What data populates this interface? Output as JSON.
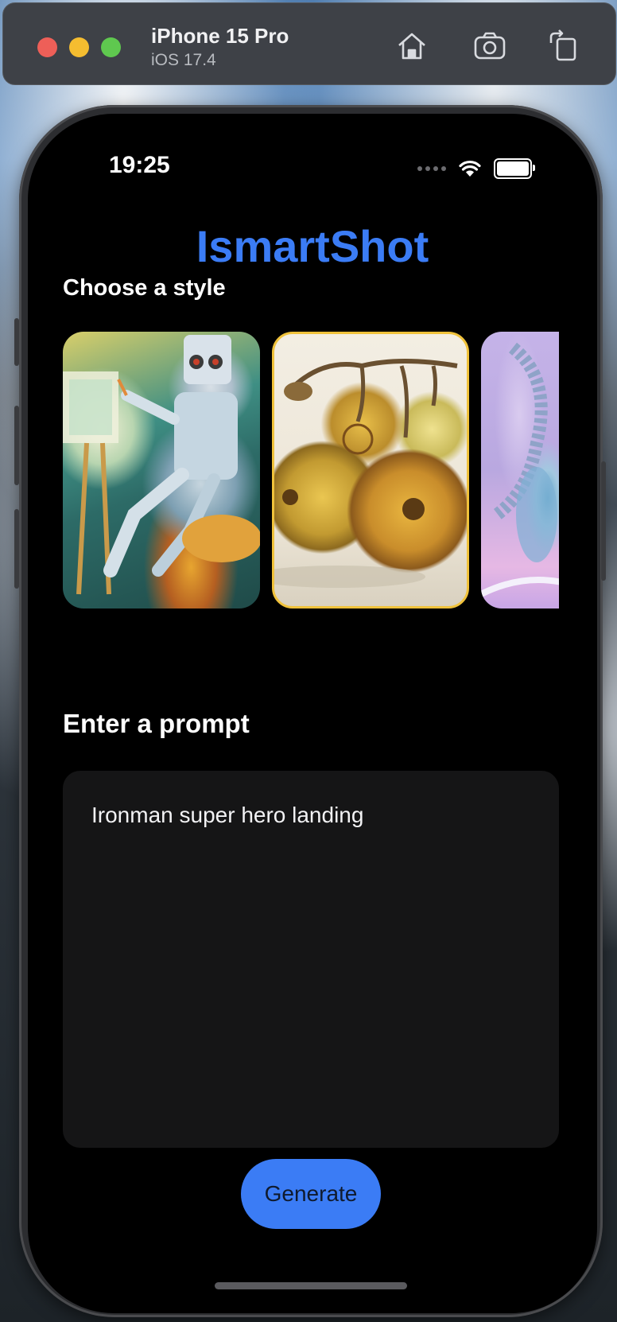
{
  "simulator": {
    "device_name": "iPhone 15 Pro",
    "os_version": "iOS 17.4",
    "toolbar_icons": [
      "home-icon",
      "camera-icon",
      "rotate-icon"
    ]
  },
  "status_bar": {
    "time": "19:25",
    "icons": [
      "signal-dots-icon",
      "wifi-icon",
      "battery-icon"
    ]
  },
  "app": {
    "title": "IsmartShot",
    "accent_color": "#3b7cf5",
    "style_section_label": "Choose a style",
    "styles": [
      {
        "name": "robot-painter-style",
        "selected": false
      },
      {
        "name": "fruit-still-life-style",
        "selected": true
      },
      {
        "name": "abstract-glass-style",
        "selected": false
      }
    ],
    "selected_border_color": "#f0c23b",
    "prompt_section_label": "Enter a prompt",
    "prompt_value": "Ironman super hero landing",
    "generate_label": "Generate"
  }
}
